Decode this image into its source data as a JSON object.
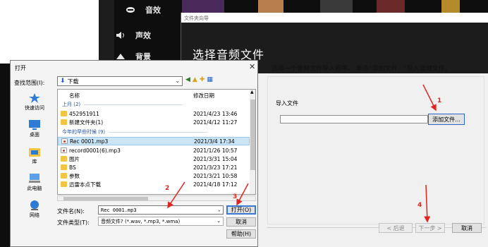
{
  "background_app": {
    "items": [
      {
        "label": "音效",
        "icon": "smile-icon"
      },
      {
        "label": "声效",
        "icon": "speaker-icon"
      },
      {
        "label": "背景",
        "icon": "triangle-icon"
      }
    ]
  },
  "wizard": {
    "title": "文件夹向导",
    "header": "选择音频文件",
    "instruction": "选择一个音频文件导入程序。 单击“添加文件...”导入音频文件。",
    "import_label": "导入文件",
    "import_value": "",
    "add_file": "添加文件...",
    "back": "< 后退",
    "next": "下一步 >",
    "cancel": "取消"
  },
  "open_dialog": {
    "title": "打开",
    "look_in_label": "查找范围(I):",
    "look_in_value": "下载",
    "nav": [
      "快速访问",
      "桌面",
      "库",
      "此电脑",
      "网络"
    ],
    "columns": {
      "name": "名称",
      "date": "修改日期"
    },
    "groups": [
      "上月 (2)",
      "今年的早些时候 (9)"
    ],
    "files_last_month": [
      {
        "name": "452951911",
        "date": "2021/4/23 13:46",
        "type": "folder"
      },
      {
        "name": "新建文件夹(1)",
        "date": "2021/4/12 11:27",
        "type": "folder"
      }
    ],
    "files_this_year": [
      {
        "name": "Rec 0001.mp3",
        "date": "2021/3/4 17:34",
        "type": "mp3"
      },
      {
        "name": "record0001(6).mp3",
        "date": "2021/1/26 10:57",
        "type": "mp3"
      },
      {
        "name": "图片",
        "date": "2021/3/31 15:04",
        "type": "folder"
      },
      {
        "name": "BS",
        "date": "2021/3/23 17:21",
        "type": "folder"
      },
      {
        "name": "参数",
        "date": "2021/3/21 10:58",
        "type": "folder"
      },
      {
        "name": "迅雷本点下载",
        "date": "2021/4/18 17:12",
        "type": "folder"
      }
    ],
    "filename_label": "文件名(N):",
    "filename_value": "Rec 0001.mp3",
    "filetype_label": "文件类型(T):",
    "filetype_value": "音频文件? (*.wav, *.mp3, *.wma)",
    "open": "打开(O)",
    "cancel": "取消",
    "help": "帮助(H)"
  },
  "annotations": [
    "1",
    "2",
    "3",
    "4"
  ],
  "colors": {
    "annotation": "#e0251f",
    "selection": "#cce4f7",
    "accent": "#2a66c8"
  }
}
